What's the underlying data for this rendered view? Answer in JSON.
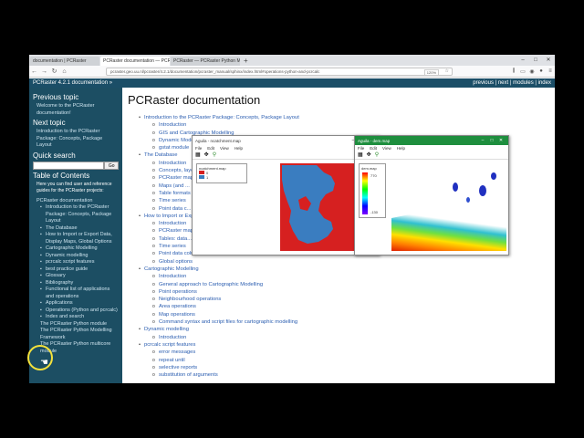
{
  "tabs": [
    {
      "label": "documentation | PCRaster"
    },
    {
      "label": "PCRaster documentation — PCRa..."
    },
    {
      "label": "PCRaster — PCRaster Python Mo..."
    }
  ],
  "url": "pcraster.geo.uu.nl/pcraster/4.2.1/documentation/pcraster_manual/sphinx/index.html#operations-python-and-pcrcalc",
  "zoom": "120%",
  "doc_header": {
    "title": "PCRaster 4.2.1 documentation »",
    "nav": "previous | next | modules | index"
  },
  "sidebar": {
    "prev_heading": "Previous topic",
    "prev_link": "Welcome to the PCRaster documentation!",
    "next_heading": "Next topic",
    "next_link": "Introduction to the PCRaster Package: Concepts, Package Layout",
    "search_heading": "Quick search",
    "go": "Go",
    "toc_heading": "Table of Contents",
    "toc_note": "Here you can find user and reference guides for the PCRaster projects:",
    "toc_root": "PCRaster documentation",
    "toc_items": [
      "Introduction to the PCRaster Package: Concepts, Package Layout",
      "The Database",
      "How to Import or Export Data, Display Maps, Global Options",
      "Cartographic Modelling",
      "Dynamic modelling",
      "pcrcalc script features",
      "best practice guide",
      "Glossary",
      "Bibliography",
      "Functional list of applications and operations",
      "Applications",
      "Operations (Python and pcrcalc)",
      "Index and search"
    ],
    "extra": [
      "The PCRaster Python module",
      "The PCRaster Python Modelling Framework",
      "The PCRaster Python multicore module"
    ]
  },
  "main": {
    "title": "PCRaster documentation",
    "toc": [
      {
        "label": "Introduction to the PCRaster Package: Concepts, Package Layout",
        "children": [
          "Introduction",
          "GIS and Cartographic Modelling",
          "Dynamic Modelling",
          "gstat module"
        ]
      },
      {
        "label": "The Database",
        "children": [
          "Introduction",
          "Concepts, layout...",
          "PCRaster maps",
          "Maps (and ...",
          "Table formats",
          "Time series",
          "Point data c..."
        ]
      },
      {
        "label": "How to Import or Export Data, Display Maps, Global Options",
        "children": [
          "Introduction",
          "PCRaster maps",
          "Tables: data...",
          "Time series",
          "Point data column files: database management",
          "Global options"
        ]
      },
      {
        "label": "Cartographic Modelling",
        "children": [
          "Introduction",
          "General approach to Cartographic Modelling",
          "Point operations",
          "Neighbourhood operations",
          "Area operations",
          "Map operations",
          "Command syntax and script files for cartographic modelling"
        ]
      },
      {
        "label": "Dynamic modelling",
        "children": [
          "Introduction"
        ]
      },
      {
        "label": "pcrcalc script features",
        "children": [
          "error messages",
          "repeat until",
          "selective reports",
          "substitution of arguments"
        ]
      }
    ]
  },
  "window1": {
    "title": "Aguila - ncatchment.map",
    "menu": [
      "File",
      "Edit",
      "View",
      "Help"
    ],
    "legend_title": "ncatchment.map",
    "legend": [
      {
        "label": "0",
        "color": "#d62020"
      },
      {
        "label": "1",
        "color": "#3a7dc0"
      }
    ]
  },
  "window2": {
    "title": "Aguila - dem.map",
    "menu": [
      "File",
      "Edit",
      "View",
      "Help"
    ],
    "legend_title": "dem.map",
    "legend_max": "770",
    "legend_min": "-130"
  }
}
